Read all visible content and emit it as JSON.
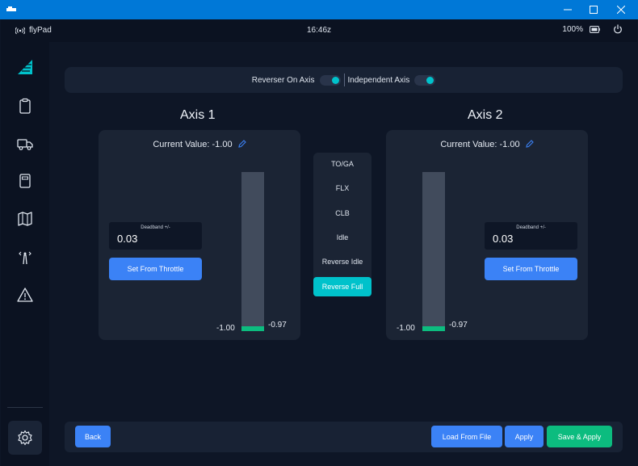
{
  "window": {
    "title_icon": "app-icon",
    "minimize": "minimize-icon",
    "maximize": "maximize-icon",
    "close": "close-icon"
  },
  "status": {
    "device": "flyPad",
    "time": "16:46z",
    "battery": "100%"
  },
  "sidebar": {
    "items": [
      "airline-logo-icon",
      "clipboard-icon",
      "truck-icon",
      "calculator-icon",
      "map-icon",
      "atc-icon",
      "warning-icon"
    ],
    "settings": "gear-icon"
  },
  "toggles": {
    "reverser_label": "Reverser On Axis",
    "reverser_on": true,
    "independent_label": "Independent Axis",
    "independent_on": true
  },
  "axis1": {
    "title": "Axis 1",
    "current_value": "Current Value: -1.00",
    "deadband_label": "Deadband +/-",
    "deadband_value": "0.03",
    "set_button": "Set From Throttle",
    "bar_min_label": "-1.00",
    "bar_max_label": "-0.97"
  },
  "axis2": {
    "title": "Axis 2",
    "current_value": "Current Value: -1.00",
    "deadband_label": "Deadband +/-",
    "deadband_value": "0.03",
    "set_button": "Set From Throttle",
    "bar_min_label": "-1.00",
    "bar_max_label": "-0.97"
  },
  "detents": [
    "TO/GA",
    "FLX",
    "CLB",
    "Idle",
    "Reverse Idle",
    "Reverse Full"
  ],
  "active_detent": "Reverse Full",
  "footer": {
    "back": "Back",
    "load": "Load From File",
    "apply": "Apply",
    "save_apply": "Save & Apply"
  },
  "colors": {
    "accent": "#00c2cb",
    "primary": "#3b82f6",
    "success": "#0cbc7f",
    "panel": "#1b2434",
    "background": "#0e1626"
  }
}
